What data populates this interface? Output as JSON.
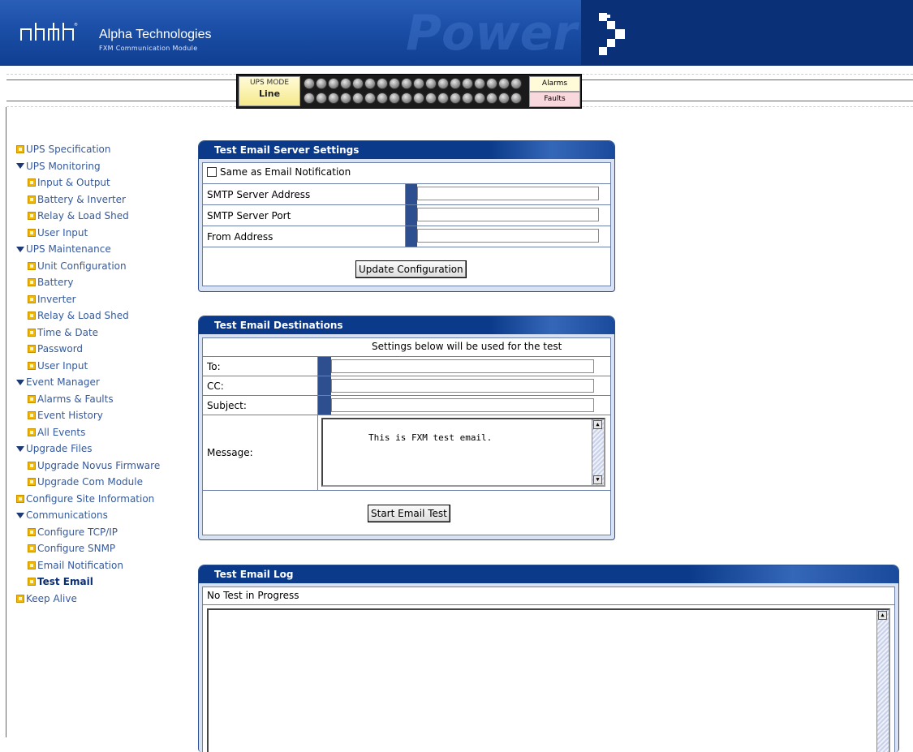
{
  "header": {
    "brand_title": "Alpha Technologies",
    "brand_subtitle": "FXM Communication Module",
    "watermark": "Power",
    "colors": {
      "banner": "#0b3d91",
      "accent": "#f2b600"
    }
  },
  "status": {
    "ups_mode_label": "UPS MODE",
    "ups_mode_value": "Line",
    "alarms_label": "Alarms",
    "faults_label": "Faults"
  },
  "sidebar": {
    "items": [
      {
        "label": "UPS Specification",
        "icon": "bullet-icon",
        "level": 0
      },
      {
        "label": "UPS Monitoring",
        "icon": "triangle-down-icon",
        "level": 0
      },
      {
        "label": "Input & Output",
        "icon": "bullet-icon",
        "level": 1
      },
      {
        "label": "Battery & Inverter",
        "icon": "bullet-icon",
        "level": 1
      },
      {
        "label": "Relay & Load Shed",
        "icon": "bullet-icon",
        "level": 1
      },
      {
        "label": "User Input",
        "icon": "bullet-icon",
        "level": 1
      },
      {
        "label": "UPS Maintenance",
        "icon": "triangle-down-icon",
        "level": 0
      },
      {
        "label": "Unit Configuration",
        "icon": "bullet-icon",
        "level": 1
      },
      {
        "label": "Battery",
        "icon": "bullet-icon",
        "level": 1
      },
      {
        "label": "Inverter",
        "icon": "bullet-icon",
        "level": 1
      },
      {
        "label": "Relay & Load Shed",
        "icon": "bullet-icon",
        "level": 1
      },
      {
        "label": "Time & Date",
        "icon": "bullet-icon",
        "level": 1
      },
      {
        "label": "Password",
        "icon": "bullet-icon",
        "level": 1
      },
      {
        "label": "User Input",
        "icon": "bullet-icon",
        "level": 1
      },
      {
        "label": "Event Manager",
        "icon": "triangle-down-icon",
        "level": 0
      },
      {
        "label": "Alarms & Faults",
        "icon": "bullet-icon",
        "level": 1
      },
      {
        "label": "Event History",
        "icon": "bullet-icon",
        "level": 1
      },
      {
        "label": "All Events",
        "icon": "bullet-icon",
        "level": 1
      },
      {
        "label": "Upgrade Files",
        "icon": "triangle-down-icon",
        "level": 0
      },
      {
        "label": "Upgrade Novus Firmware",
        "icon": "bullet-icon",
        "level": 1
      },
      {
        "label": "Upgrade Com Module",
        "icon": "bullet-icon",
        "level": 1
      },
      {
        "label": "Configure Site Information",
        "icon": "bullet-icon",
        "level": 0
      },
      {
        "label": "Communications",
        "icon": "triangle-down-icon",
        "level": 0
      },
      {
        "label": "Configure TCP/IP",
        "icon": "bullet-icon",
        "level": 1
      },
      {
        "label": "Configure SNMP",
        "icon": "bullet-icon",
        "level": 1
      },
      {
        "label": "Email Notification",
        "icon": "bullet-icon",
        "level": 1
      },
      {
        "label": "Test Email",
        "icon": "bullet-icon",
        "level": 1,
        "active": true
      },
      {
        "label": "Keep Alive",
        "icon": "bullet-icon",
        "level": 0
      }
    ]
  },
  "server_settings": {
    "title": "Test Email Server Settings",
    "same_as_label": "Same as Email Notification",
    "smtp_address_label": "SMTP Server Address",
    "smtp_address_value": "",
    "smtp_port_label": "SMTP Server Port",
    "smtp_port_value": "",
    "from_label": "From Address",
    "from_value": "",
    "update_button": "Update Configuration"
  },
  "destinations": {
    "title": "Test Email Destinations",
    "note": "Settings below will be used for the test",
    "to_label": "To:",
    "to_value": "",
    "cc_label": "CC:",
    "cc_value": "",
    "subject_label": "Subject:",
    "subject_value": "",
    "message_label": "Message:",
    "message_value": "This is FXM test email.",
    "start_button": "Start Email Test"
  },
  "log": {
    "title": "Test Email Log",
    "status": "No Test in Progress",
    "content": ""
  }
}
